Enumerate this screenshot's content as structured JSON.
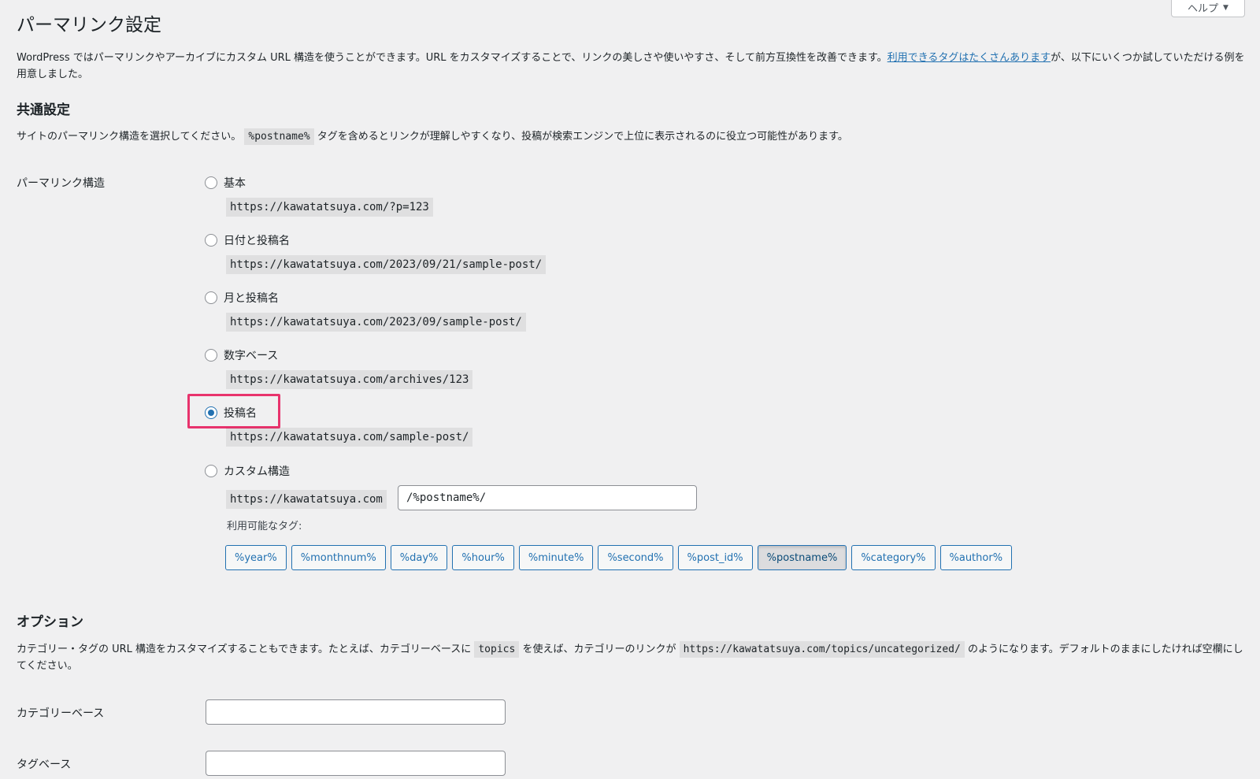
{
  "help": {
    "label": "ヘルプ",
    "arrow": "▼"
  },
  "page_title": "パーマリンク設定",
  "intro": {
    "text_before": "WordPress ではパーマリンクやアーカイブにカスタム URL 構造を使うことができます。URL をカスタマイズすることで、リンクの美しさや使いやすさ、そして前方互換性を改善できます。",
    "link": "利用できるタグはたくさんあります",
    "text_after": "が、以下にいくつか試していただける例を用意しました。"
  },
  "common": {
    "heading": "共通設定",
    "desc_before": "サイトのパーマリンク構造を選択してください。",
    "desc_code": "%postname%",
    "desc_after": " タグを含めるとリンクが理解しやすくなり、投稿が検索エンジンで上位に表示されるのに役立つ可能性があります。",
    "row_label": "パーマリンク構造",
    "options": [
      {
        "label": "基本",
        "example": "https://kawatatsuya.com/?p=123",
        "checked": false
      },
      {
        "label": "日付と投稿名",
        "example": "https://kawatatsuya.com/2023/09/21/sample-post/",
        "checked": false
      },
      {
        "label": "月と投稿名",
        "example": "https://kawatatsuya.com/2023/09/sample-post/",
        "checked": false
      },
      {
        "label": "数字ベース",
        "example": "https://kawatatsuya.com/archives/123",
        "checked": false
      },
      {
        "label": "投稿名",
        "example": "https://kawatatsuya.com/sample-post/",
        "checked": true
      },
      {
        "label": "カスタム構造",
        "example": "https://kawatatsuya.com",
        "checked": false
      }
    ],
    "custom_value": "/%postname%/",
    "tags_label": "利用可能なタグ:",
    "tags": [
      {
        "label": "%year%",
        "active": false
      },
      {
        "label": "%monthnum%",
        "active": false
      },
      {
        "label": "%day%",
        "active": false
      },
      {
        "label": "%hour%",
        "active": false
      },
      {
        "label": "%minute%",
        "active": false
      },
      {
        "label": "%second%",
        "active": false
      },
      {
        "label": "%post_id%",
        "active": false
      },
      {
        "label": "%postname%",
        "active": true
      },
      {
        "label": "%category%",
        "active": false
      },
      {
        "label": "%author%",
        "active": false
      }
    ]
  },
  "options_section": {
    "heading": "オプション",
    "desc_1": "カテゴリー・タグの URL 構造をカスタマイズすることもできます。たとえば、カテゴリーベースに",
    "code_1": "topics",
    "desc_2": "を使えば、カテゴリーのリンクが",
    "code_2": "https://kawatatsuya.com/topics/uncategorized/",
    "desc_3": "のようになります。デフォルトのままにしたければ空欄にしてください。",
    "category_base_label": "カテゴリーベース",
    "category_base_value": "",
    "tag_base_label": "タグベース",
    "tag_base_value": ""
  },
  "colors": {
    "accent": "#2271b1",
    "highlight": "#e8336d",
    "background": "#f0f0f1"
  }
}
